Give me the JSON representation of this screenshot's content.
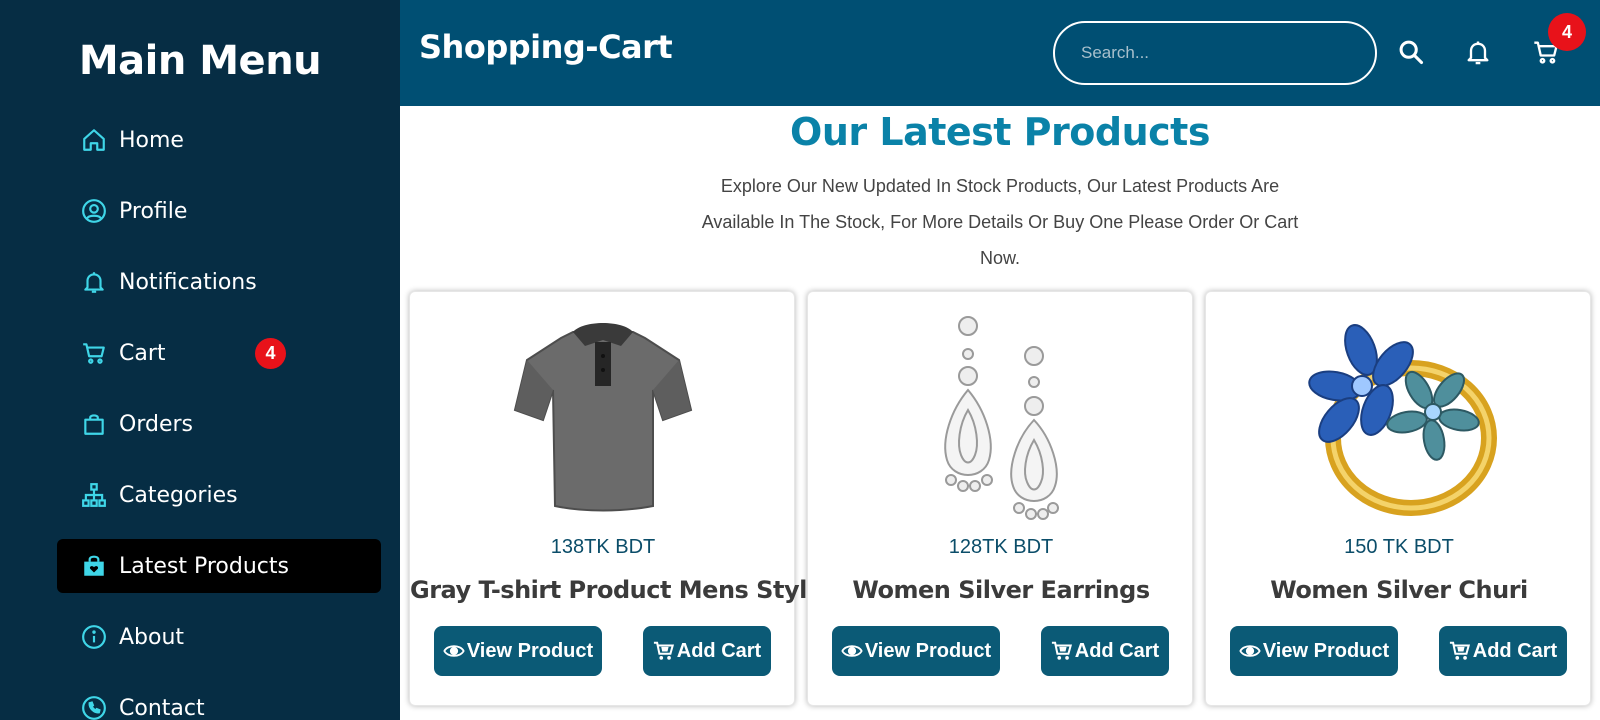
{
  "sidebar": {
    "title": "Main Menu",
    "items": [
      {
        "label": "Home",
        "icon": "home-icon"
      },
      {
        "label": "Profile",
        "icon": "user-circle-icon"
      },
      {
        "label": "Notifications",
        "icon": "bell-icon"
      },
      {
        "label": "Cart",
        "icon": "cart-icon",
        "badge": "4"
      },
      {
        "label": "Orders",
        "icon": "shopping-bag-icon"
      },
      {
        "label": "Categories",
        "icon": "sitemap-icon"
      },
      {
        "label": "Latest Products",
        "icon": "shopping-bag-heart-icon",
        "active": true
      },
      {
        "label": "About",
        "icon": "info-circle-icon"
      },
      {
        "label": "Contact",
        "icon": "phone-icon"
      }
    ]
  },
  "header": {
    "title": "Shopping-Cart",
    "search_placeholder": "Search...",
    "cart_badge": "4"
  },
  "main": {
    "title": "Our Latest Products",
    "description": "Explore Our New Updated In Stock Products, Our Latest Products Are Available In The Stock, For More Details Or Buy One Please Order Or Cart Now.",
    "products": [
      {
        "price": "138TK BDT",
        "name": "Gray T-shirt Product Mens Styling",
        "image": "gray-polo-shirt",
        "view_label": "View Product",
        "add_label": "Add Cart"
      },
      {
        "price": "128TK BDT",
        "name": "Women Silver Earrings",
        "image": "silver-earrings",
        "view_label": "View Product",
        "add_label": "Add Cart"
      },
      {
        "price": "150 TK BDT",
        "name": "Women Silver Churi",
        "image": "gold-flower-ring",
        "view_label": "View Product",
        "add_label": "Add Cart"
      }
    ]
  },
  "colors": {
    "sidebar_bg": "#062d44",
    "header_bg": "#004f73",
    "accent_icon": "#3fd6e8",
    "title_blue": "#0a82a8",
    "button_bg": "#0b5a76",
    "badge_red": "#e8121a"
  }
}
